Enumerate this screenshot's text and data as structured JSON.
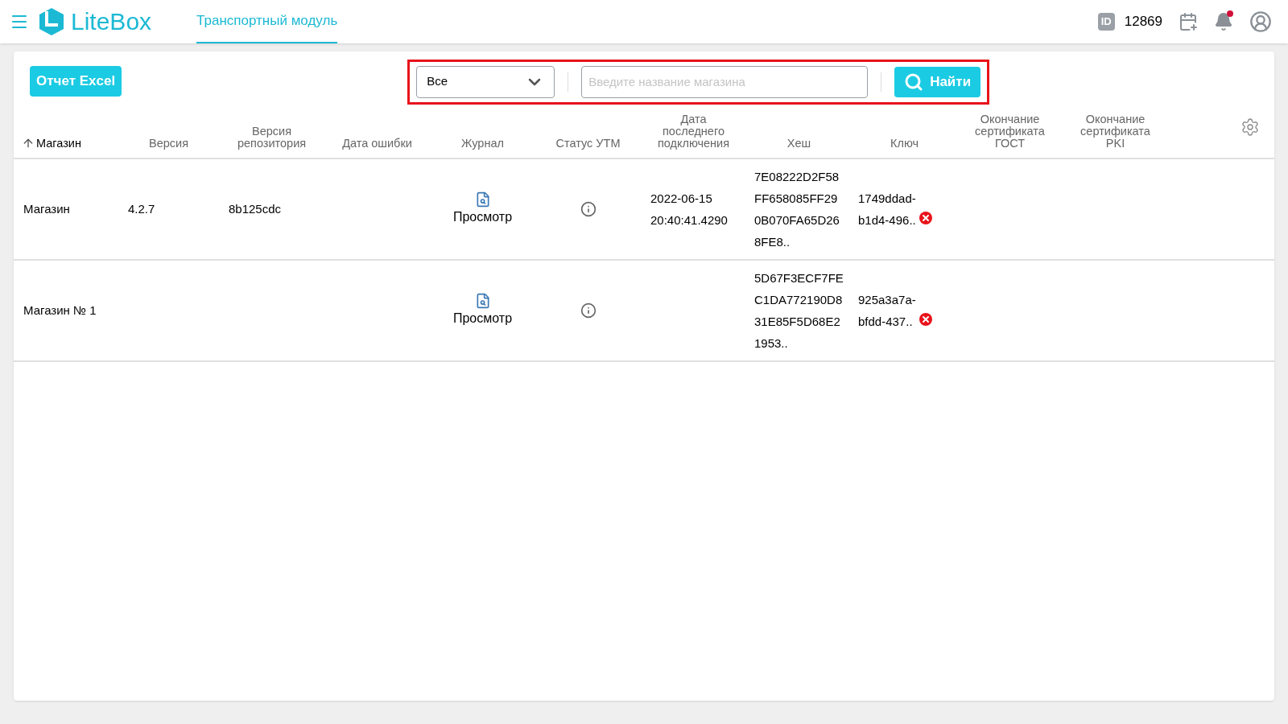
{
  "header": {
    "logo": "LiteBox",
    "nav_tabs": [
      {
        "label": "Транспортный модуль",
        "selected": true
      }
    ],
    "id_badge": "ID",
    "id_label": "12869",
    "notification_unread": true
  },
  "toolbar": {
    "excel_button": "Отчет Excel",
    "filter": {
      "value": "Все"
    },
    "search": {
      "placeholder": "Введите название магазина"
    },
    "find_button": "Найти"
  },
  "table": {
    "columns": [
      {
        "label": "Магазин",
        "sorted": true
      },
      {
        "label": "Версия",
        "sorted": false
      },
      {
        "label": "Версия репозитория",
        "sorted": false
      },
      {
        "label": "Дата ошибки",
        "sorted": false
      },
      {
        "label": "Журнал",
        "sorted": false
      },
      {
        "label": "Статус УТМ",
        "sorted": false
      },
      {
        "label": "Дата последнего подключения",
        "sorted": false
      },
      {
        "label": "Хеш",
        "sorted": false
      },
      {
        "label": "Ключ",
        "sorted": false
      },
      {
        "label": "Окончание сертификата ГОСТ",
        "sorted": false
      },
      {
        "label": "Окончание сертификата PKI",
        "sorted": false
      }
    ],
    "rows": [
      {
        "store": "Магазин",
        "version": "4.2.7",
        "repo_version": "8b125cdc",
        "journal": "Просмотр",
        "last_connection": [
          "2022-06-15",
          "20:40:41.4290"
        ],
        "hash": [
          "7E08222D2F58",
          "FF658085FF29",
          "0B070FA65D26",
          "8FE8.."
        ],
        "key": [
          "1749ddad-",
          "b1d4-496.."
        ],
        "key_error": true
      },
      {
        "store": "Магазин № 1",
        "journal": "Просмотр",
        "hash": [
          "5D67F3ECF7FE",
          "C1DA772190D8",
          "31E85F5D68E2",
          "1953.."
        ],
        "key": [
          "925a3a7a-",
          "bfdd-437.."
        ],
        "key_error": true
      }
    ]
  }
}
